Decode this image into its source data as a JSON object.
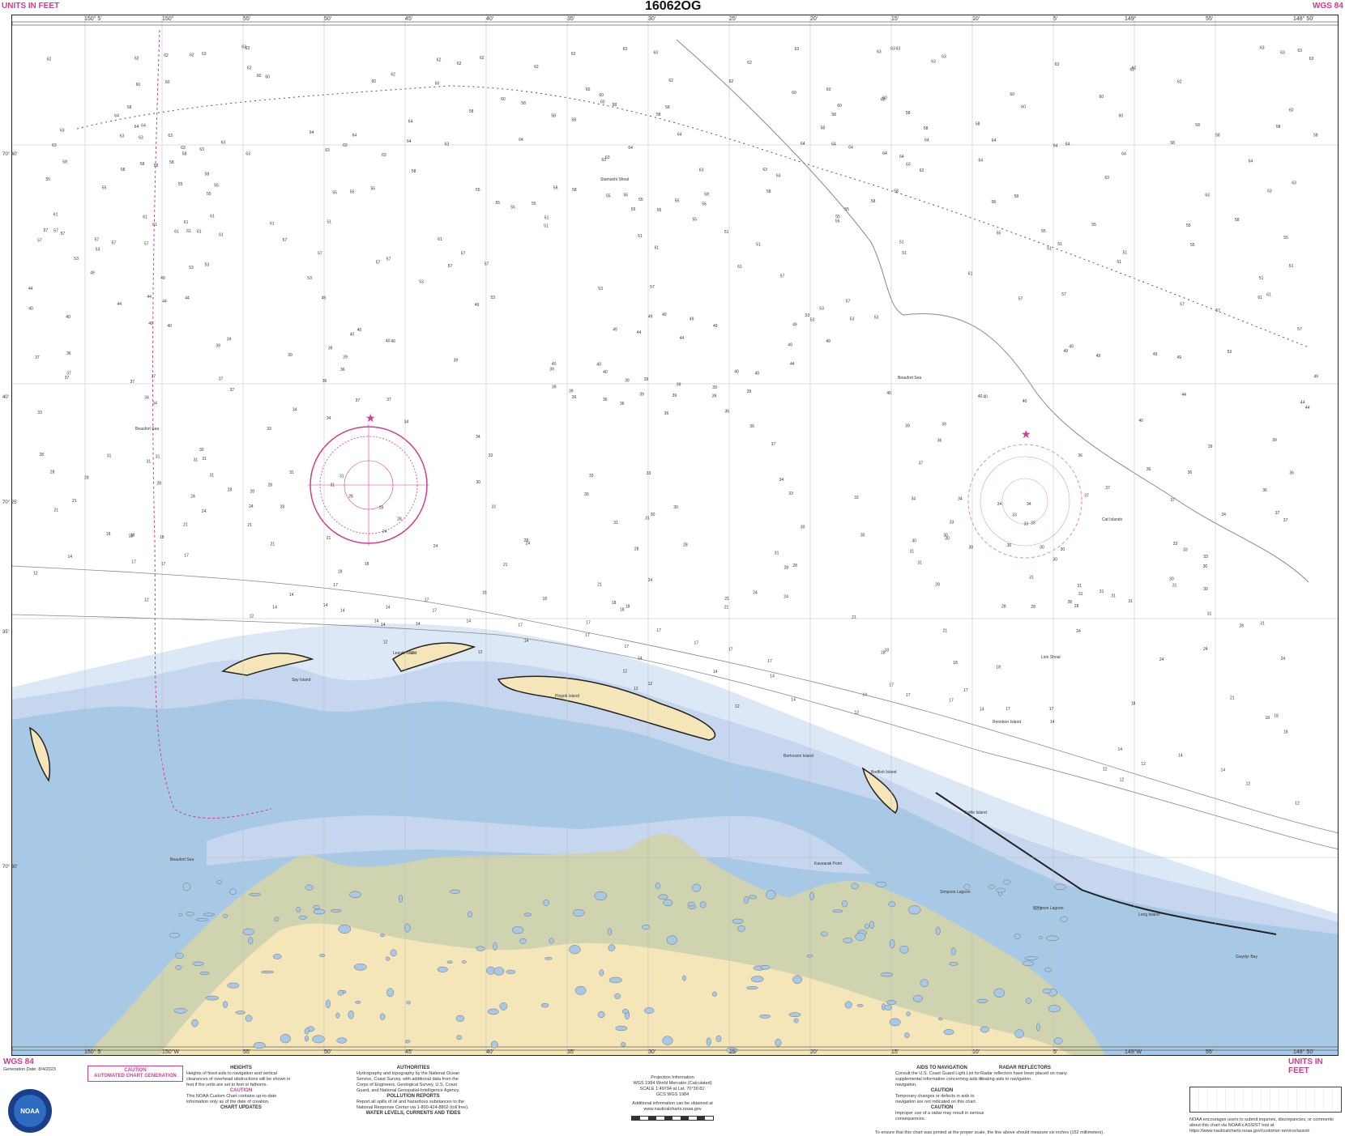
{
  "header": {
    "left_units": "UNITS IN FEET",
    "chart_number": "16062OG",
    "right_datum": "WGS 84",
    "bottom_left_datum": "WGS 84",
    "bottom_right_units": "UNITS IN FEET"
  },
  "longitude_labels_top": [
    "150° 5'",
    "150°",
    "55'",
    "50'",
    "45'",
    "40'",
    "35'",
    "30'",
    "25'",
    "20'",
    "15'",
    "10'",
    "5'",
    "149°",
    "55'",
    "148° 50'"
  ],
  "longitude_labels_bottom": [
    "150° 5'",
    "150°W",
    "55'",
    "50'",
    "45'",
    "40'",
    "35'",
    "30'",
    "25'",
    "20'",
    "15'",
    "10'",
    "5'",
    "149°W",
    "55'",
    "148° 50'"
  ],
  "latitude_labels": [
    "70° 40'",
    "40'",
    "35'",
    "70° 30'",
    "70° 25'"
  ],
  "place_names": {
    "stamukhi_shoal": "Stamukhi Shoal",
    "beaufort_sea_1": "Beaufort Sea",
    "beaufort_sea_2": "Beaufort Sea",
    "beaufort_sea_3": "Beaufort Sea",
    "spy_island": "Spy Island",
    "leavitt_island": "Leavitt Island",
    "pingok_island": "Pingok Island",
    "bertoncini_island": "Bertoncini Island",
    "bodfish_island": "Bodfish Island",
    "cottle_island": "Cottle Island",
    "simpson_lagoon": "Simpson Lagoon",
    "gwydyr_bay": "Gwydyr Bay",
    "long_island": "Long Island",
    "reindeer_island": "Reindeer Island",
    "kavearak_point": "Kavearak Point",
    "simpson_lagoon_2": "Simpson Lagoon",
    "lion_shoal": "Lion Shoal",
    "cat_islands": "Cat Islands"
  },
  "footer": {
    "generation": "Generation Date: 8/4/2023",
    "caution_title": "CAUTION",
    "caution_sub": "AUTOMATED CHART GENERATION",
    "heights_title": "HEIGHTS",
    "heights_text": "Heights of fixed aids to navigation and vertical clearances of overhead obstructions will be shown in feet if the units are set to feet or fathoms.",
    "caution2_title": "CAUTION",
    "caution2_text": "This NOAA Custom Chart contains up-to-date information only as of the date of creation.",
    "chart_updates_title": "CHART UPDATES",
    "authorities_title": "AUTHORITIES",
    "authorities_text": "Hydrography and topography by the National Ocean Service, Coast Survey, with additional data from the Corps of Engineers, Geological Survey, U.S. Coast Guard, and National Geospatial-Intelligence Agency.",
    "pollution_title": "POLLUTION REPORTS",
    "pollution_text": "Report all spills of oil and hazardous substances to the National Response Center via 1-800-424-8802 (toll free).",
    "water_levels_title": "WATER LEVELS, CURRENTS AND TIDES",
    "projection_title": "Projection Information",
    "projection_1": "WGS 1984 World Mercator (Calculated)",
    "projection_2": "SCALE 1:49794 at Lat. 70°30.81'",
    "projection_3": "GCS WGS 1984",
    "additional_info": "Additional information can be obtained at www.nauticalcharts.noaa.gov",
    "aids_title": "AIDS TO NAVIGATION",
    "aids_text": "Consult the U.S. Coast Guard Light List for supplemental information concerning aids to navigation.",
    "caution3_title": "CAUTION",
    "caution3_text": "Temporary changes or defects in aids to navigation are not indicated on this chart.",
    "caution4_title": "CAUTION",
    "caution4_text": "Improper use of a radar may result in serious consequences.",
    "radar_title": "RADAR REFLECTORS",
    "radar_text": "Radar reflectors have been placed on many floating aids to navigation.",
    "scale_note": "To ensure that this chart was printed at the proper scale, the line above should measure six inches (152 millimeters).",
    "noaa_badge": "NOAA",
    "noaa_note": "NOAA encourages users to submit inquiries, discrepancies, or comments about this chart via NOAA's ASSIST tool at https://www.nauticalcharts.noaa.gov/customer-service/assist/"
  },
  "depths_offshore": [
    "60",
    "63",
    "62",
    "60",
    "58",
    "64",
    "63",
    "58",
    "55",
    "51",
    "61",
    "57",
    "53",
    "49",
    "44",
    "40",
    "39",
    "36",
    "37",
    "34",
    "33",
    "30",
    "31",
    "28",
    "24",
    "21",
    "18",
    "17",
    "14",
    "12"
  ],
  "colors": {
    "land": "#f4e6b8",
    "marsh": "#cfd3b0",
    "shallow": "#a8c9e6",
    "mid": "#c6d6ee",
    "deep_tint": "#dde8f7",
    "magenta": "#d63a8e",
    "line": "#555555"
  }
}
